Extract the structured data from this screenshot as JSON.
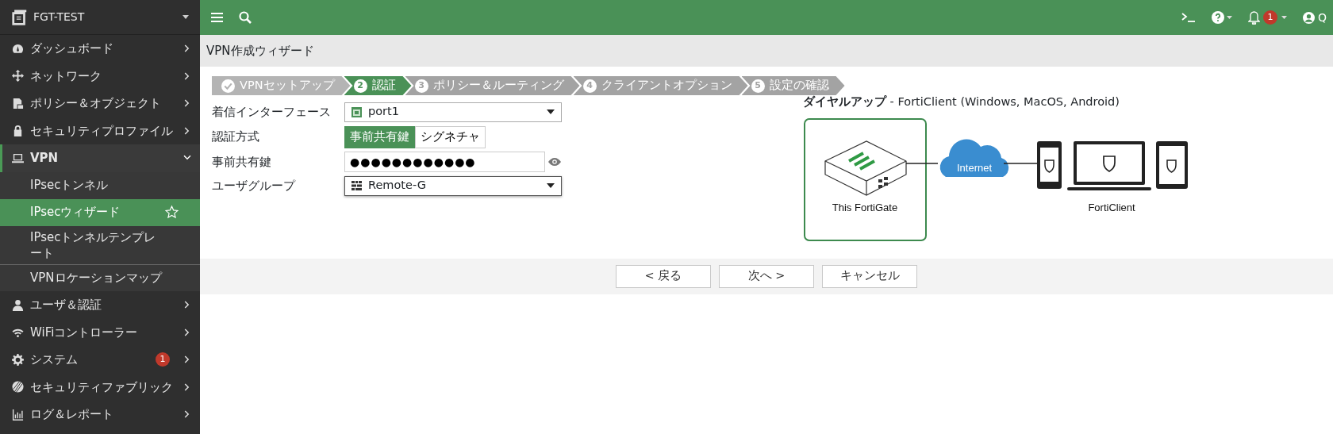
{
  "sidebar": {
    "device": "FGT-TEST",
    "items": [
      {
        "label": "ダッシュボード",
        "expanded": false
      },
      {
        "label": "ネットワーク",
        "expanded": false
      },
      {
        "label": "ポリシー＆オブジェクト",
        "expanded": false
      },
      {
        "label": "セキュリティプロファイル",
        "expanded": false
      },
      {
        "label": "VPN",
        "expanded": true,
        "children": [
          {
            "label": "IPsecトンネル",
            "selected": false
          },
          {
            "label": "IPsecウィザード",
            "selected": true
          },
          {
            "label": "IPsecトンネルテンプレート",
            "selected": false
          },
          {
            "label": "VPNロケーションマップ",
            "selected": false
          }
        ]
      },
      {
        "label": "ユーザ＆認証",
        "expanded": false
      },
      {
        "label": "WiFiコントローラー",
        "expanded": false
      },
      {
        "label": "システム",
        "expanded": false,
        "badge": "1"
      },
      {
        "label": "セキュリティファブリック",
        "expanded": false
      },
      {
        "label": "ログ＆レポート",
        "expanded": false
      }
    ]
  },
  "topbar": {
    "notification_count": "1",
    "user": "Q"
  },
  "page_title": "VPN作成ウィザード",
  "steps": [
    {
      "label": "VPNセットアップ",
      "completed": true,
      "selected": false
    },
    {
      "number": "2",
      "label": "認証",
      "completed": false,
      "selected": true
    },
    {
      "number": "3",
      "label": "ポリシー＆ルーティング",
      "completed": false,
      "selected": false
    },
    {
      "number": "4",
      "label": "クライアントオプション",
      "completed": false,
      "selected": false
    },
    {
      "number": "5",
      "label": "設定の確認",
      "completed": false,
      "selected": false
    }
  ],
  "form": {
    "interface": {
      "label": "着信インターフェース",
      "value": "port1"
    },
    "auth_method": {
      "label": "認証方式",
      "options": [
        {
          "label": "事前共有鍵",
          "selected": true
        },
        {
          "label": "シグネチャ",
          "selected": false
        }
      ]
    },
    "psk": {
      "label": "事前共有鍵",
      "value": "●●●●●●●●●●●●"
    },
    "user_group": {
      "label": "ユーザグループ",
      "value": "Remote-G"
    }
  },
  "diagram": {
    "title_bold": "ダイヤルアップ",
    "title_rest": "- FortiClient (Windows, MacOS, Android)",
    "cloud": "Internet",
    "left": "This FortiGate",
    "right": "FortiClient"
  },
  "buttons": [
    "< 戻る",
    "次へ >",
    "キャンセル"
  ]
}
